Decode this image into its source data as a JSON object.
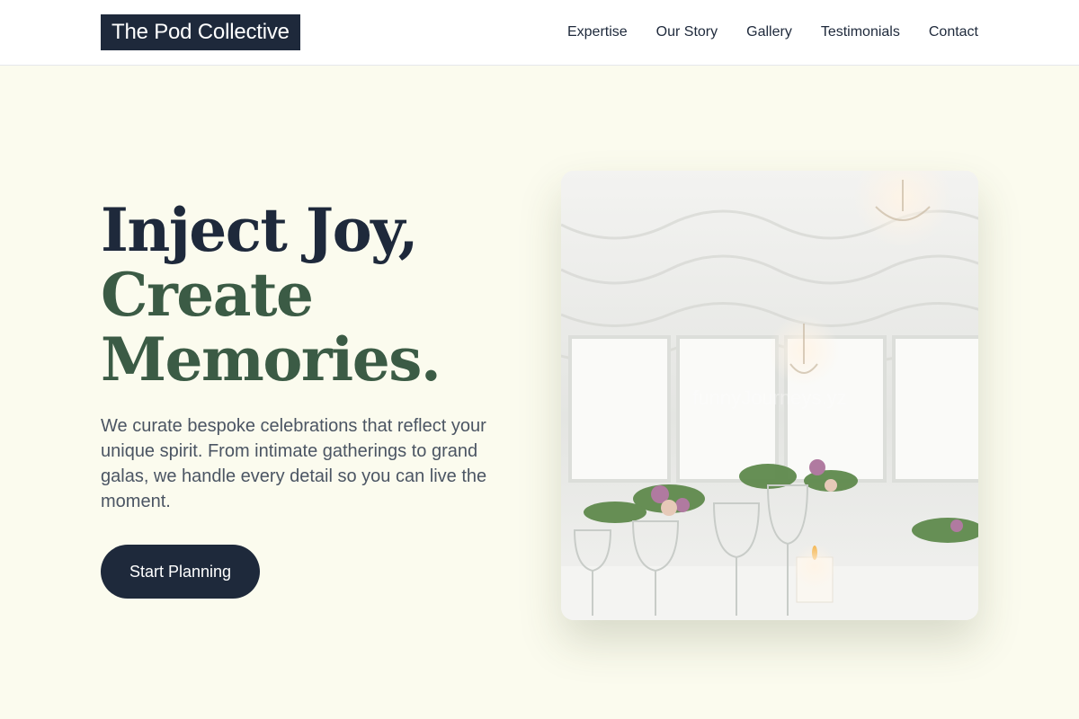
{
  "header": {
    "logo": "The Pod Collective",
    "nav": [
      "Expertise",
      "Our Story",
      "Gallery",
      "Testimonials",
      "Contact"
    ]
  },
  "hero": {
    "headline_line1": "Inject Joy,",
    "headline_line2": "Create",
    "headline_line3": "Memories.",
    "description": "We curate bespoke celebrations that reflect your unique spirit. From intimate gatherings to grand galas, we handle every detail so you can live the moment.",
    "cta_label": "Start Planning",
    "image_alt": "Elegant wedding reception table with glassware, candles and floral arrangements under a white draped tent"
  },
  "colors": {
    "page_background": "#fbfbee",
    "header_background": "#ffffff",
    "navy": "#1e293b",
    "forest_green": "#3b5b45",
    "body_text": "#4b5563"
  },
  "icons": {}
}
